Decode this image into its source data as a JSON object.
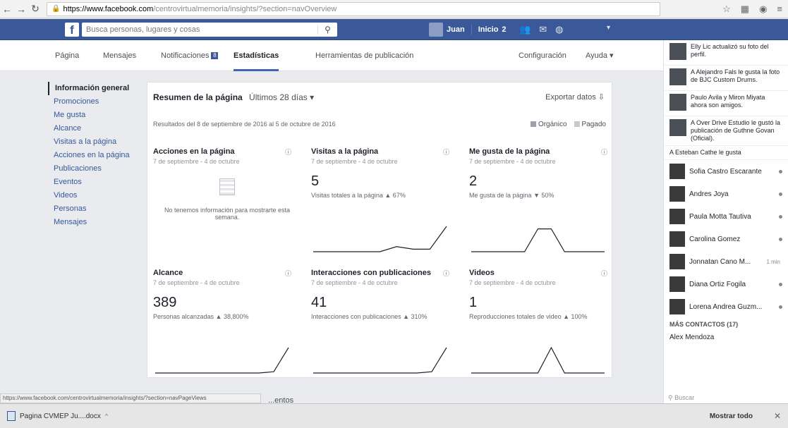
{
  "browser": {
    "url_host": "https://www.facebook.com",
    "url_path": "/centrovirtualmemoria/insights/?section=navOverview"
  },
  "fb_header": {
    "logo": "f",
    "search_placeholder": "Busca personas, lugares y cosas",
    "user_name": "Juan",
    "home_label": "Inicio",
    "home_count": "2"
  },
  "page_tabs": {
    "pagina": "Página",
    "mensajes": "Mensajes",
    "notificaciones": "Notificaciones",
    "notificaciones_count": "8",
    "estadisticas": "Estadísticas",
    "herramientas": "Herramientas de publicación",
    "configuracion": "Configuración",
    "ayuda": "Ayuda ▾"
  },
  "left_nav": [
    "Información general",
    "Promociones",
    "Me gusta",
    "Alcance",
    "Visitas a la página",
    "Acciones en la página",
    "Publicaciones",
    "Eventos",
    "Videos",
    "Personas",
    "Mensajes"
  ],
  "summary": {
    "title": "Resumen de la página",
    "range": "Últimos 28 días ▾",
    "export": "Exportar datos",
    "dates": "Resultados del 8 de septiembre de 2016 al 5 de octubre de 2016",
    "legend_organic": "Orgánico",
    "legend_paid": "Pagado"
  },
  "cards": {
    "acciones": {
      "title": "Acciones en la página",
      "sub": "7 de septiembre - 4 de octubre",
      "nodata": "No tenemos información para mostrarte esta semana."
    },
    "visitas": {
      "title": "Visitas a la página",
      "sub": "7 de septiembre - 4 de octubre",
      "value": "5",
      "stat": "Visitas totales a la página ▲ 67%"
    },
    "megusta": {
      "title": "Me gusta de la página",
      "sub": "7 de septiembre - 4 de octubre",
      "value": "2",
      "stat": "Me gusta de la página ▼ 50%"
    },
    "alcance": {
      "title": "Alcance",
      "sub": "7 de septiembre - 4 de octubre",
      "value": "389",
      "stat": "Personas alcanzadas ▲ 38,800%"
    },
    "interacciones": {
      "title": "Interacciones con publicaciones",
      "sub": "7 de septiembre - 4 de octubre",
      "value": "41",
      "stat": "Interacciones con publicaciones ▲ 310%"
    },
    "videos": {
      "title": "Videos",
      "sub": "7 de septiembre - 4 de octubre",
      "value": "1",
      "stat": "Reproducciones totales de video ▲ 100%"
    }
  },
  "sparklines": {
    "visitas": [
      0,
      0,
      0,
      0,
      0,
      0.2,
      0.1,
      0.1,
      1
    ],
    "megusta": [
      0,
      0,
      0,
      0,
      0,
      0.9,
      0.9,
      0,
      0,
      0,
      0
    ],
    "alcance": [
      0,
      0,
      0,
      0,
      0,
      0,
      0,
      0,
      0.05,
      1
    ],
    "interacciones": [
      0,
      0,
      0,
      0,
      0,
      0,
      0,
      0,
      0.05,
      1
    ],
    "videos": [
      0,
      0,
      0,
      0,
      0,
      0,
      1,
      0,
      0,
      0,
      0
    ]
  },
  "bottom_strip": "...entos",
  "ticker": [
    {
      "text": "Elly Lic actualizó su foto del perfil."
    },
    {
      "text": "A Alejandro Fals le gusta la foto de BJC Custom Drums."
    },
    {
      "text": "Paulo Avila y Miron Miyata ahora son amigos."
    },
    {
      "text": "A Over Drive Estudio le gustó la publicación de Guthne Govan (Oficial)."
    },
    {
      "text": "A Esteban Cathe le gusta"
    }
  ],
  "contacts": [
    {
      "name": "Sofia Castro Escarante",
      "extra": ""
    },
    {
      "name": "Andres Joya",
      "extra": ""
    },
    {
      "name": "Paula Motta Tautiva",
      "extra": ""
    },
    {
      "name": "Carolina Gomez",
      "extra": ""
    },
    {
      "name": "Jonnatan Cano M...",
      "extra": "1 min"
    },
    {
      "name": "Diana Ortiz Fogila",
      "extra": ""
    },
    {
      "name": "Lorena Andrea Guzm...",
      "extra": ""
    }
  ],
  "more_contacts": "MÁS CONTACTOS (17)",
  "more_contact_first": "Alex Mendoza",
  "right_search": "Buscar",
  "status_url": "https://www.facebook.com/centrovirtualmemoria/insights/?section=navPageViews",
  "download": {
    "file": "Pagina CVMEP Ju....docx",
    "show_all": "Mostrar todo"
  }
}
